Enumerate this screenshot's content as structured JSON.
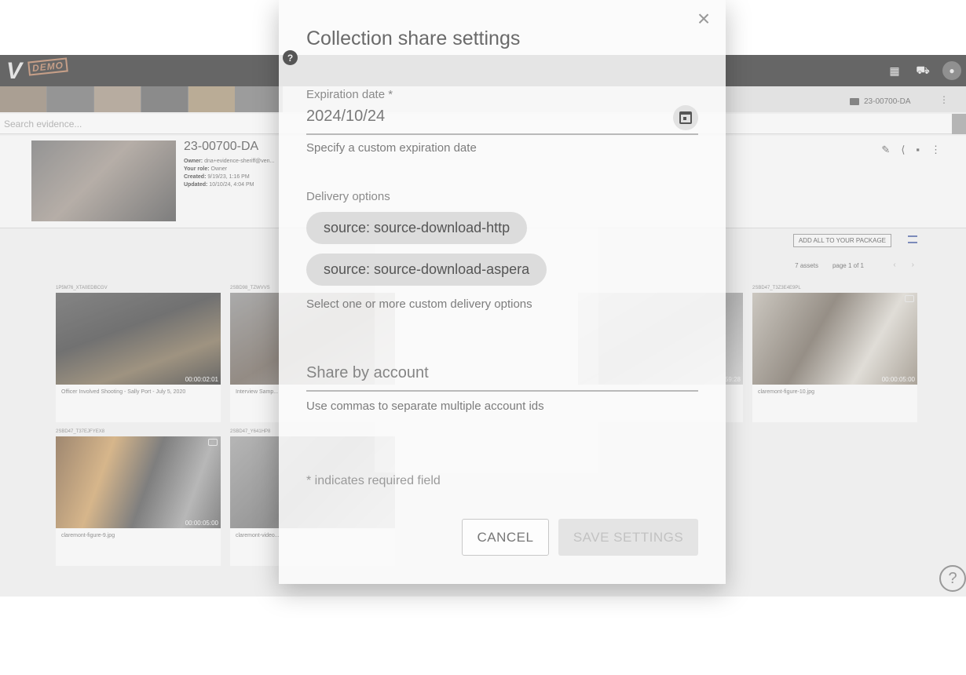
{
  "background_app": {
    "logo": "V",
    "logo_badge": "DEMO",
    "case_chip": "23-00700-DA",
    "search_placeholder": "Search evidence...",
    "case": {
      "title": "23-00700-DA",
      "owner_label": "Owner:",
      "owner": "dna+evidence-sheriff@ven...",
      "role_label": "Your role:",
      "role": "Owner",
      "created_label": "Created:",
      "created": "9/19/23, 1:16 PM",
      "updated_label": "Updated:",
      "updated": "10/10/24, 4:04 PM"
    },
    "add_package_label": "ADD ALL TO YOUR PACKAGE",
    "asset_count": "7 assets",
    "page_label": "page 1 of 1",
    "cards": [
      {
        "id": "1P5M76_XTA0EDBCGV",
        "duration": "00:00:02:01",
        "caption": "Officer Involved Shooting - Sally Port - July 5, 2020"
      },
      {
        "id": "2SBD98_TZWVVS",
        "duration": "",
        "caption": "Interview Samp..."
      },
      {
        "id": "",
        "duration": "59:28",
        "caption": ""
      },
      {
        "id": "2SBD47_T3Z3E4E9PL",
        "duration": "00:00:05:00",
        "caption": "claremont-figure-10.jpg"
      },
      {
        "id": "2SBD47_T37EJFYEX8",
        "duration": "00:00:05:00",
        "caption": "claremont-figure-9.jpg"
      },
      {
        "id": "2SBD47_Y641HP8",
        "duration": "",
        "caption": "claremont-video..."
      }
    ],
    "help_icon": "?"
  },
  "dialog": {
    "title": "Collection share settings",
    "close_icon": "×",
    "help_icon": "?",
    "expiration": {
      "label": "Expiration date *",
      "value": "2024/10/24",
      "helper": "Specify a custom expiration date"
    },
    "delivery": {
      "label": "Delivery options",
      "chips": [
        "source: source-download-http",
        "source: source-download-aspera"
      ],
      "helper": "Select one or more custom delivery options"
    },
    "share": {
      "placeholder": "Share by account",
      "helper": "Use commas to separate multiple account ids"
    },
    "required_note": "* indicates required field",
    "cancel_label": "CANCEL",
    "save_label": "SAVE SETTINGS"
  },
  "colors": {
    "topbar": "#2b2b2b",
    "chip_bg": "#dcdcdc",
    "save_disabled_bg": "#e4e4e4",
    "accent_list_icon": "#4a5fa0"
  }
}
